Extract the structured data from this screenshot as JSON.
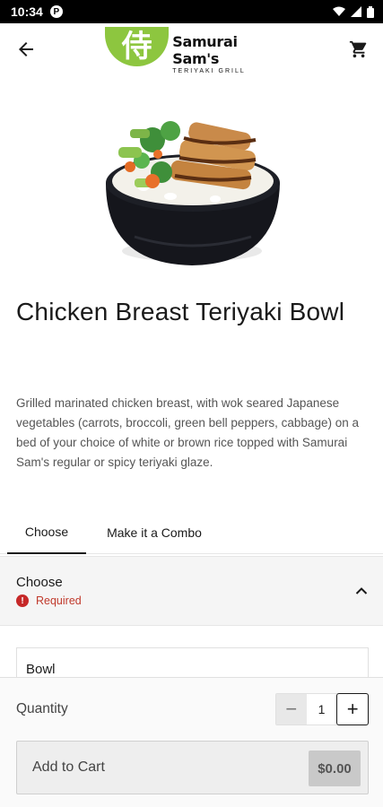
{
  "status_bar": {
    "time": "10:34",
    "app_badge": "P"
  },
  "app_bar": {
    "logo_glyph": "侍",
    "logo_name": "Samurai Sam's",
    "logo_sub": "TERIYAKI GRILL",
    "back_icon": "arrow-left-icon",
    "cart_icon": "cart-icon",
    "brand_color": "#8dc63f"
  },
  "product": {
    "title": "Chicken Breast Teriyaki Bowl",
    "description": "Grilled marinated chicken breast, with wok seared Japanese vegetables (carrots, broccoli, green bell peppers, cabbage) on a bed of your choice of white or brown rice topped with Samurai Sam's regular or spicy teriyaki glaze."
  },
  "tabs": [
    {
      "label": "Choose",
      "active": true
    },
    {
      "label": "Make it a Combo",
      "active": false
    }
  ],
  "choose_section": {
    "title": "Choose",
    "required_label": "Required",
    "options": [
      {
        "label": "Bowl"
      }
    ]
  },
  "order": {
    "quantity_label": "Quantity",
    "quantity_value": "1",
    "minus_symbol": "−",
    "plus_symbol": "+",
    "add_to_cart_label": "Add to Cart",
    "price": "$0.00"
  },
  "colors": {
    "required": "#c62828",
    "text": "#1a1a1a"
  }
}
